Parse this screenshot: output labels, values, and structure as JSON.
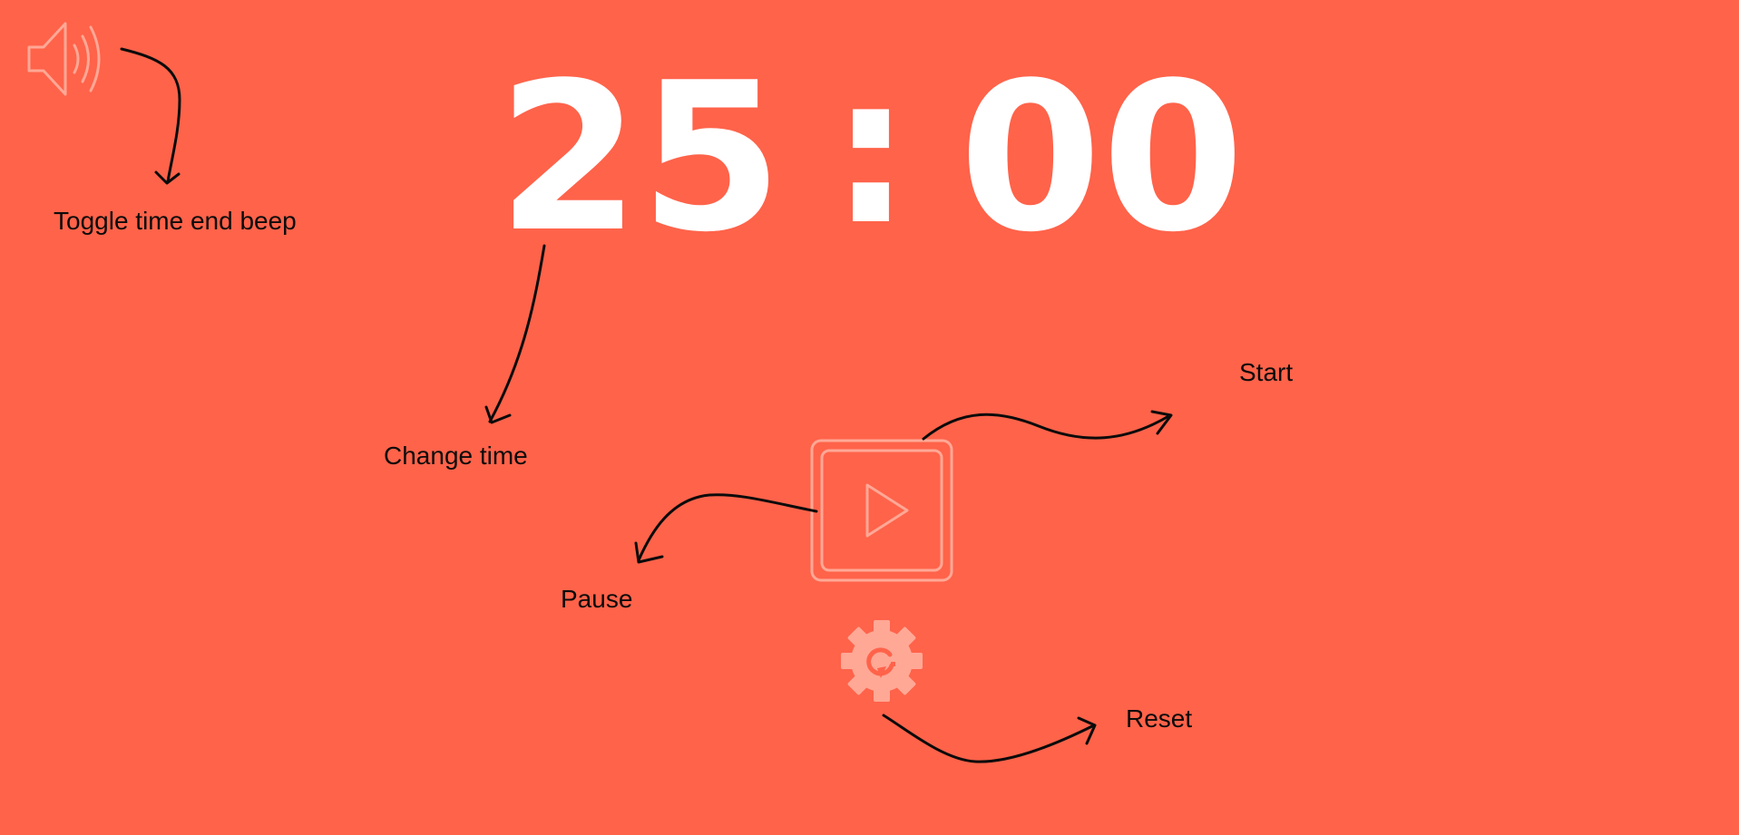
{
  "timer": {
    "minutes": "25",
    "separator": ":",
    "seconds": "00"
  },
  "controls": {
    "sound_icon": "speaker-sound-on-icon",
    "play_icon": "play-icon",
    "reset_icon": "gear-reset-icon"
  },
  "annotations": {
    "toggle_beep": "Toggle time end beep",
    "change_time": "Change time",
    "start": "Start",
    "pause": "Pause",
    "reset": "Reset"
  },
  "colors": {
    "background": "#ff634a",
    "timer_text": "#ffffff",
    "icon": "#ffa896",
    "annotation": "#0b0b0b"
  }
}
